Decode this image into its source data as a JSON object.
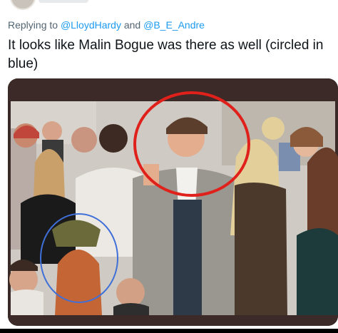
{
  "reply": {
    "prefix": "Replying to ",
    "mention1": "@LloydHardy",
    "conjunction": " and ",
    "mention2": "@B_E_Andre"
  },
  "tweet": {
    "text": "It looks like Malin Bogue was there as well (circled in blue)"
  },
  "media": {
    "icon": "photo",
    "red_circle_color": "#e0201a",
    "blue_circle_color": "#3f6fd8"
  },
  "colors": {
    "mention": "#1d9bf0",
    "secondary_text": "#536471",
    "text": "#0f1419"
  }
}
